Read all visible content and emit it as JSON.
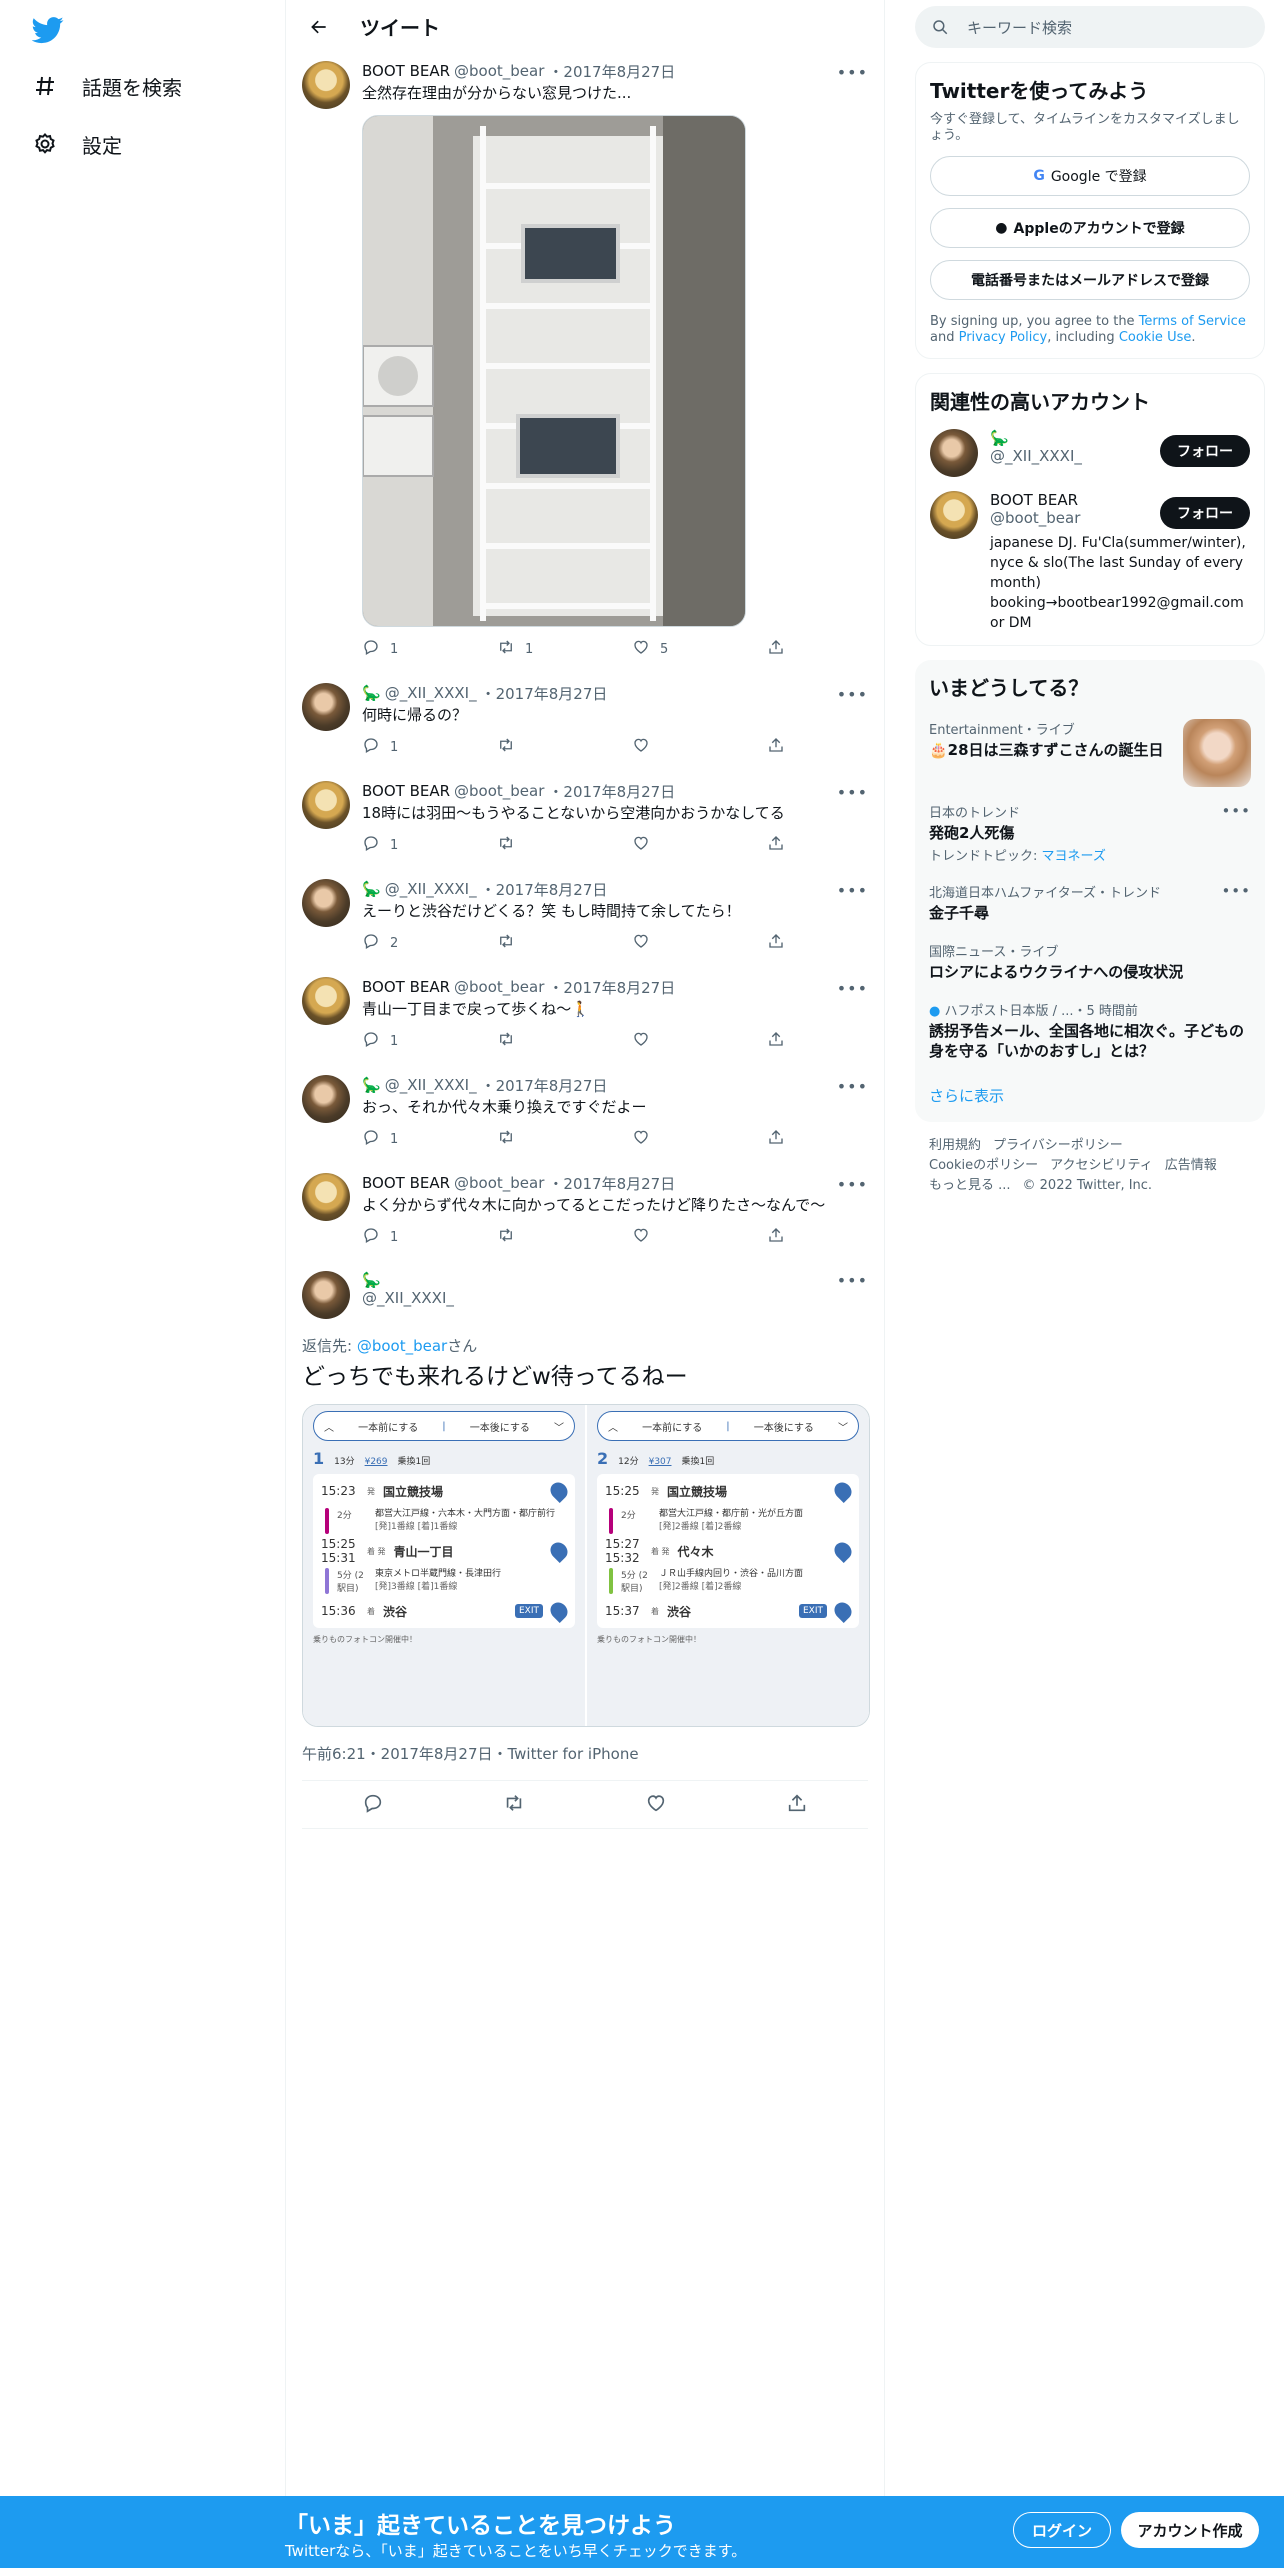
{
  "nav": {
    "explore": "話題を検索",
    "settings": "設定"
  },
  "header": {
    "title": "ツイート"
  },
  "thread": [
    {
      "name": "BOOT BEAR",
      "handle": "@boot_bear",
      "date": "・2017年8月27日",
      "text": "全然存在理由が分からない窓見つけた...",
      "replies": "1",
      "retweets": "1",
      "likes": "5",
      "has_photo": true
    },
    {
      "name": "🦕",
      "handle": "@_XII_XXXI_",
      "date": "・2017年8月27日",
      "text": "何時に帰るの？",
      "replies": "1",
      "retweets": "",
      "likes": ""
    },
    {
      "name": "BOOT BEAR",
      "handle": "@boot_bear",
      "date": "・2017年8月27日",
      "text": "18時には羽田〜もうやることないから空港向かおうかなしてる",
      "replies": "1",
      "retweets": "",
      "likes": ""
    },
    {
      "name": "🦕",
      "handle": "@_XII_XXXI_",
      "date": "・2017年8月27日",
      "text": "えーりと渋谷だけどくる？笑 もし時間持て余してたら！",
      "replies": "2",
      "retweets": "",
      "likes": ""
    },
    {
      "name": "BOOT BEAR",
      "handle": "@boot_bear",
      "date": "・2017年8月27日",
      "text": "青山一丁目まで戻って歩くね〜🚶",
      "replies": "1",
      "retweets": "",
      "likes": ""
    },
    {
      "name": "🦕",
      "handle": "@_XII_XXXI_",
      "date": "・2017年8月27日",
      "text": "おっ、それか代々木乗り換えですぐだよー",
      "replies": "1",
      "retweets": "",
      "likes": ""
    },
    {
      "name": "BOOT BEAR",
      "handle": "@boot_bear",
      "date": "・2017年8月27日",
      "text": "よく分からず代々木に向かってるとこだったけど降りたさ〜なんで〜",
      "replies": "1",
      "retweets": "",
      "likes": ""
    }
  ],
  "main_tweet": {
    "name": "🦕",
    "handle": "@_XII_XXXI_",
    "reply_prefix": "返信先: ",
    "reply_to": "@boot_bear",
    "reply_suffix": "さん",
    "text": "どっちでも来れるけどw待ってるねー",
    "timestamp": "午前6:21・2017年8月27日・Twitter for iPhone",
    "routes": [
      {
        "prev": "一本前にする",
        "next": "一本後にする",
        "num": "1",
        "mins": "13分",
        "fare": "¥269",
        "transfers": "乗換1回",
        "stops": [
          {
            "time": "15:23",
            "sfx": "発",
            "name": "国立競技場"
          },
          {
            "line": "都営大江戸線・六本木・大門方面・都庁前行",
            "plat": "[発]1番線 [着]1番線",
            "dur": "2分",
            "color": "#b6007a"
          },
          {
            "time": "15:25 15:31",
            "sfx": "着 発",
            "name": "青山一丁目"
          },
          {
            "line": "東京メトロ半蔵門線・長津田行",
            "plat": "[発]3番線 [着]1番線",
            "dur": "5分 (2駅目)",
            "color": "#8f76d6"
          },
          {
            "time": "15:36",
            "sfx": "着",
            "name": "渋谷",
            "exit": "EXIT"
          }
        ],
        "note": "乗りものフォトコン開催中！"
      },
      {
        "prev": "一本前にする",
        "next": "一本後にする",
        "num": "2",
        "mins": "12分",
        "fare": "¥307",
        "transfers": "乗換1回",
        "stops": [
          {
            "time": "15:25",
            "sfx": "発",
            "name": "国立競技場"
          },
          {
            "line": "都営大江戸線・都庁前・光が丘方面",
            "plat": "[発]2番線 [着]2番線",
            "dur": "2分",
            "color": "#b6007a"
          },
          {
            "time": "15:27 15:32",
            "sfx": "着 発",
            "name": "代々木"
          },
          {
            "line": "ＪＲ山手線内回り・渋谷・品川方面",
            "plat": "[発]2番線 [着]2番線",
            "dur": "5分 (2駅目)",
            "color": "#80c241"
          },
          {
            "time": "15:37",
            "sfx": "着",
            "name": "渋谷",
            "exit": "EXIT"
          }
        ],
        "note": "乗りものフォトコン開催中！"
      }
    ]
  },
  "sidebar": {
    "search_placeholder": "キーワード検索",
    "signup": {
      "title": "Twitterを使ってみよう",
      "subtitle": "今すぐ登録して、タイムラインをカスタマイズしましょう。",
      "google": "Google で登録",
      "apple": "Appleのアカウントで登録",
      "phone": "電話番号またはメールアドレスで登録",
      "legal_1": "By signing up, you agree to the ",
      "tos": "Terms of Service",
      "legal_2": " and ",
      "privacy": "Privacy Policy",
      "legal_3": ", including ",
      "cookie": "Cookie Use",
      "legal_4": "."
    },
    "related": {
      "title": "関連性の高いアカウント",
      "accounts": [
        {
          "name": "🦕",
          "handle": "@_XII_XXXI_",
          "follow": "フォロー"
        },
        {
          "name": "BOOT BEAR",
          "handle": "@boot_bear",
          "follow": "フォロー",
          "bio": "japanese DJ. Fu'Cla(summer/winter), nyce & slo(The last Sunday of every month) booking→bootbear1992@gmail.com or DM"
        }
      ]
    },
    "trends": {
      "title": "いまどうしてる？",
      "items": [
        {
          "category": "Entertainment・ライブ",
          "title": "🎂28日は三森すずこさんの誕生日"
        },
        {
          "category": "日本のトレンド",
          "title": "発砲2人死傷",
          "topic_label": "トレンドトピック: ",
          "topic": "マヨネーズ"
        },
        {
          "category": "北海道日本ハムファイターズ・トレンド",
          "title": "金子千尋"
        },
        {
          "category": "国際ニュース・ライブ",
          "title": "ロシアによるウクライナへの侵攻状況"
        },
        {
          "category": "ハフポスト日本版 / ...",
          "time": "・5 時間前",
          "title": "誘拐予告メール、全国各地に相次ぐ。子どもの身を守る「いかのおすし」とは？"
        }
      ],
      "show_more": "さらに表示"
    },
    "footer": [
      "利用規約",
      "プライバシーポリシー",
      "Cookieのポリシー",
      "アクセシビリティ",
      "広告情報",
      "もっと見る ...",
      "© 2022 Twitter, Inc."
    ]
  },
  "bottom_bar": {
    "title": "「いま」起きていることを見つけよう",
    "subtitle": "Twitterなら、「いま」起きていることをいち早くチェックできます。",
    "login": "ログイン",
    "signup": "アカウント作成"
  }
}
